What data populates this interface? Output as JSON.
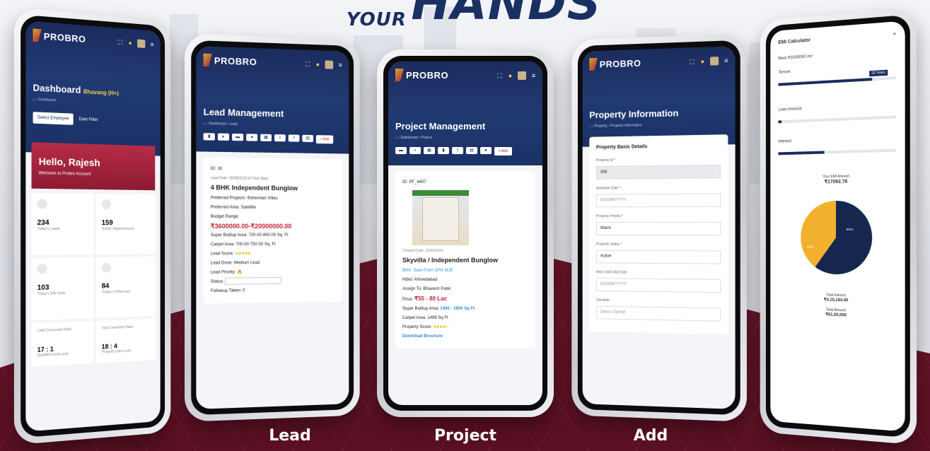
{
  "headline": {
    "line1": "YOUR",
    "line2": "HANDS"
  },
  "brand": {
    "name": "PROBRO"
  },
  "phones": {
    "dashboard": {
      "title": "Dashboard",
      "tag": "Bhavang (H+)",
      "crumb": "⌂ › Dashboard",
      "tab_active": "Select Employee",
      "tab_other": "Date Filter",
      "greeting": "Hello, Rajesh",
      "welcome": "Welcome to Probro Account",
      "stats": [
        {
          "value": "234",
          "label": "Today's Leads"
        },
        {
          "value": "159",
          "label": "Today's Appointments"
        },
        {
          "value": "103",
          "label": "Today's Site Visits"
        },
        {
          "value": "84",
          "label": "Today's Follow-ups"
        }
      ],
      "ratio_labels": [
        "Lead Converted Ratio",
        "Visit Converted Ratio"
      ],
      "ratios": [
        "17 : 1",
        "18 : 4"
      ],
      "footer": [
        "Qualified leads pool",
        "Property sold count"
      ]
    },
    "lead": {
      "title": "Lead Management",
      "crumb": "⌂ › Dashboard › Lead",
      "add": "+ Add",
      "id": "ID: 16",
      "date": "Lead Date: 30/08/2023 (6 Days Ago)",
      "type": "4 BHK Independent Bunglow",
      "preferred_projects": "Preferred Projects: Bohemian Villas",
      "preferred_area": "Preferred Area: Satellite",
      "budget_label": "Budget Range:",
      "budget": "₹3600000.00-₹20000000.00",
      "super_area": "Super Builtup Area: 700.00-800.00 Sq. Ft",
      "carpet_area": "Carpet Area: 700.00-750.00 Sq. Ft",
      "lead_score": "Lead Score:",
      "lead_stars": "★★★★★",
      "lead_done": "Lead Done: Medium Lead",
      "lead_priority": "Lead Priority:",
      "priority_icon": "🔥",
      "status": "Status:",
      "followup": "Followup Taken: 0"
    },
    "project": {
      "title": "Project Management",
      "crumb": "⌂ › Dashboard › Project",
      "add": "+ Add",
      "id": "ID: PF_4407",
      "created": "Created Date: 23/09/2023",
      "name": "Skyvilla / Independent Bunglow",
      "bhk": "BHK: Start From 2PH-3CB",
      "hiboi": "Hiboi: Ahmedabad",
      "assign": "Assign To: Bhavesh Patel",
      "price_label": "Price:",
      "price": "₹55 - 80 Lac",
      "super_label": "Super Builtup Area:",
      "super": "1400 - 1800 Sq Ft",
      "carpet": "Carpet Area: 1499 Sq Ft",
      "score_label": "Property Score:",
      "stars": "★★★★☆",
      "brochure": "Download Brochure"
    },
    "property": {
      "title": "Property Information",
      "crumb": "⌂ › Property › Property Information",
      "section": "Property Basic Details",
      "fields": [
        {
          "label": "Property Id *",
          "value": "308"
        },
        {
          "label": "Available Date *",
          "value": "DD/MM/YYYY"
        },
        {
          "label": "Property Priority *",
          "value": "Warm"
        },
        {
          "label": "Property Status *",
          "value": "Active"
        },
        {
          "label": "Rera Valid Dist Date",
          "value": "DD/MM/YYYY"
        },
        {
          "label": "Ownship",
          "value": "Select Ownsh"
        }
      ]
    },
    "emi": {
      "title": "EMI Calculator",
      "loan": "Rent ₹2000000 /m²",
      "tenure_label": "Tenure",
      "tenure_value": "20 Years",
      "interest_label": "Interest",
      "amount_label": "Loan Amount",
      "emi_label": "Your EMI Amount",
      "emi_value": "₹17092.76",
      "pie_labels": [
        "40%",
        "60%"
      ],
      "total_interest_label": "Total Interest",
      "total_interest": "₹4,10,184.00",
      "total_amount_label": "Total Amount",
      "total_amount": "₹61,00,000"
    }
  },
  "chart_data": {
    "type": "pie",
    "values": [
      60,
      40
    ],
    "labels": [
      "60%",
      "40%"
    ],
    "colors": [
      "#16264f",
      "#f1b12f"
    ]
  },
  "captions": [
    "Lead",
    "Project",
    "Add"
  ],
  "colors": {
    "navy": "#1b2c5e",
    "maroon": "#7d1a33",
    "accent_red": "#c4213d",
    "accent_gold": "#f1b12f"
  }
}
